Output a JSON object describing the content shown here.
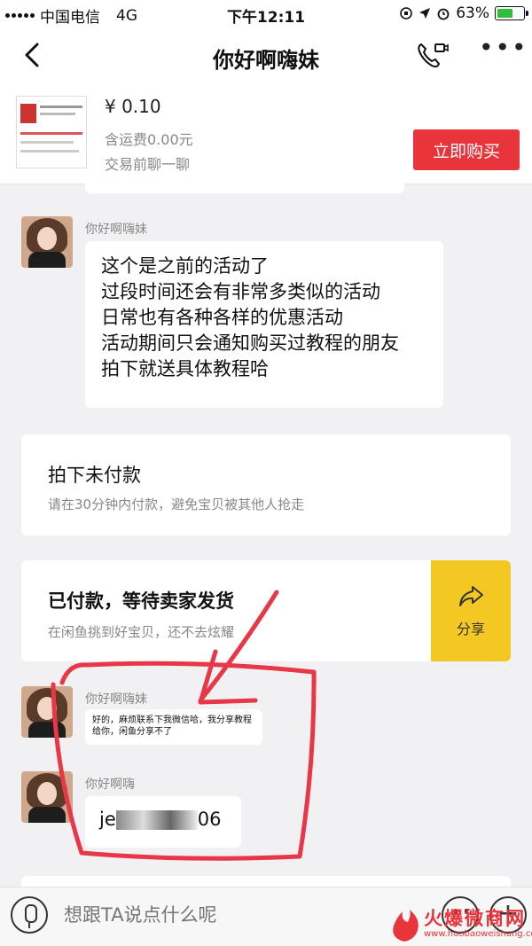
{
  "status_bar": {
    "carrier": "中国电信",
    "network": "4G",
    "time": "下午12:11",
    "battery": "63%",
    "battery_level": 0.63
  },
  "nav": {
    "title": "你好啊嗨妹"
  },
  "product": {
    "price": "¥ 0.10",
    "shipping": "含运费0.00元",
    "chat_prompt": "交易前聊一聊",
    "buy_label": "立即购买"
  },
  "messages": [
    {
      "sender": "你好啊嗨妹",
      "lines": [
        "这个是之前的活动了",
        "过段时间还会有非常多类似的活动",
        "日常也有各种各样的优惠活动",
        "活动期间只会通知购买过教程的朋友",
        "拍下就送具体教程哈"
      ]
    },
    {
      "sender": "你好啊嗨妹",
      "text": "好的，麻烦联系下我微信哈，我分享教程给你，闲鱼分享不了"
    },
    {
      "sender": "你好啊嗨",
      "text_start": "je",
      "text_end": "06"
    }
  ],
  "cards": {
    "unpaid": {
      "title": "拍下未付款",
      "subtitle": "请在30分钟内付款，避免宝贝被其他人抢走"
    },
    "paid": {
      "title": "已付款，等待卖家发货",
      "subtitle": "在闲鱼挑到好宝贝，还不去炫耀",
      "share_label": "分享"
    }
  },
  "input": {
    "placeholder": "想跟TA说点什么呢"
  },
  "watermark": {
    "name": "火爆微商网",
    "url": "www.huobaoweishang.com"
  },
  "colors": {
    "buy_button": "#e8343a",
    "share_panel": "#f3c823",
    "annotation": "#e83848"
  }
}
